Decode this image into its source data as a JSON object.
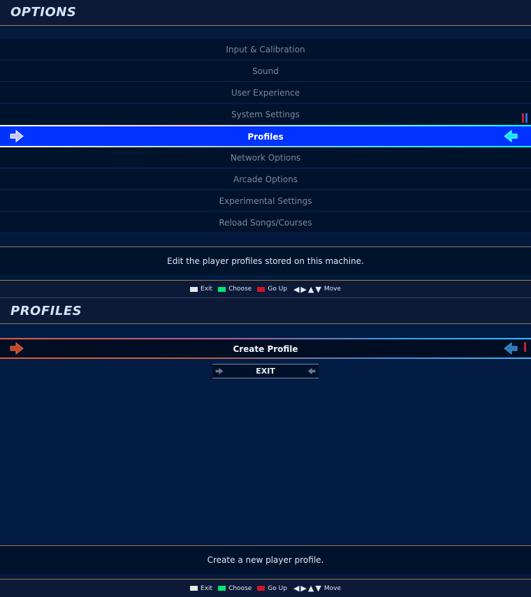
{
  "options": {
    "title": "OPTIONS",
    "items": [
      {
        "label": "Input & Calibration"
      },
      {
        "label": "Sound"
      },
      {
        "label": "User Experience"
      },
      {
        "label": "System Settings"
      },
      {
        "label": "Profiles"
      },
      {
        "label": "Network Options"
      },
      {
        "label": "Arcade Options"
      },
      {
        "label": "Experimental Settings"
      },
      {
        "label": "Reload Songs/Courses"
      }
    ],
    "selected_index": 4,
    "description": "Edit the player profiles stored on this machine."
  },
  "hints": {
    "exit": "Exit",
    "choose": "Choose",
    "go_up": "Go Up",
    "move": "Move"
  },
  "profiles": {
    "title": "PROFILES",
    "create_label": "Create Profile",
    "exit_label": "EXIT",
    "description": "Create a new player profile."
  },
  "colors": {
    "background": "#021c44",
    "selected_row": "#0033ff",
    "exit_swatch": "#e8e8e8",
    "choose_swatch": "#00e676",
    "go_up_swatch": "#d0152a",
    "accent_line": "#a07846"
  }
}
